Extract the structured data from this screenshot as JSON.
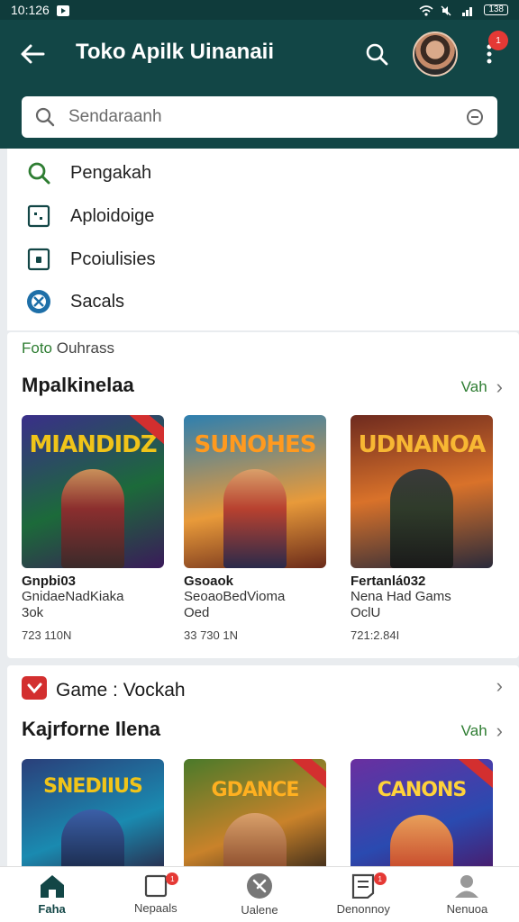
{
  "status": {
    "time": "10:126",
    "battery": "138"
  },
  "appbar": {
    "title": "Toko Apilk Uinanaii",
    "notif_count": "1"
  },
  "search": {
    "placeholder": "Sendaraanh"
  },
  "dropdown": {
    "items": [
      {
        "label": "Pengakah",
        "icon": "search-icon"
      },
      {
        "label": "Aploidoige",
        "icon": "app-box-icon"
      },
      {
        "label": "Pcoiulisies",
        "icon": "lock-box-icon"
      },
      {
        "label": "Sacals",
        "icon": "globe-icon"
      }
    ]
  },
  "section1": {
    "sub_prefix": "Foto",
    "sub_rest": " Ouhrass",
    "title": "Mpalkinelaa",
    "see_all": "Vah",
    "games": [
      {
        "thumb_title": "MIANDIDZ",
        "name": "Gnpbi03",
        "developer": "GnidaeNadKiaka",
        "developer2": "3ok",
        "size": "723 110N",
        "bg": "#3a2e8a",
        "accent": "#f0c419",
        "hero": "#8b2e2e"
      },
      {
        "thumb_title": "SUNOHES",
        "name": "Gsoaok",
        "developer": "SeoaoBedVioma",
        "developer2": "Oed",
        "size": "33 730 1N",
        "bg": "#2d7fb0",
        "accent": "#ff9a1f",
        "hero": "#b8412f"
      },
      {
        "thumb_title": "UDNANOA",
        "name": "Fertanlá032",
        "developer": "Nena Had Gams",
        "developer2": "OclU",
        "size": "721:2.84I",
        "bg": "#6e2a1f",
        "accent": "#f7b733",
        "hero": "#2f3b2a"
      }
    ]
  },
  "section2": {
    "heading": "Game : Vockah",
    "title": "Kajrforne Ilena",
    "see_all": "Vah",
    "games": [
      {
        "thumb_title": "SNEDIIUS",
        "bg": "#2a3f7a",
        "accent": "#f0c419",
        "hero": "#3b5fa8"
      },
      {
        "thumb_title": "GDANCE",
        "bg": "#4a7a2a",
        "accent": "#ffb020",
        "hero": "#8a4a2a"
      },
      {
        "thumb_title": "CANONS",
        "bg": "#6a2fa0",
        "accent": "#ffd23a",
        "hero": "#c6462a"
      }
    ]
  },
  "nav": {
    "items": [
      {
        "label": "Faha",
        "active": true
      },
      {
        "label": "Nepaals",
        "badge": "1"
      },
      {
        "label": "Ualene"
      },
      {
        "label": "Denonnoy",
        "badge": "1"
      },
      {
        "label": "Nenuoa"
      }
    ]
  },
  "colors": {
    "appbar": "#124646",
    "accent_green": "#2e7d32",
    "badge": "#e53935"
  }
}
